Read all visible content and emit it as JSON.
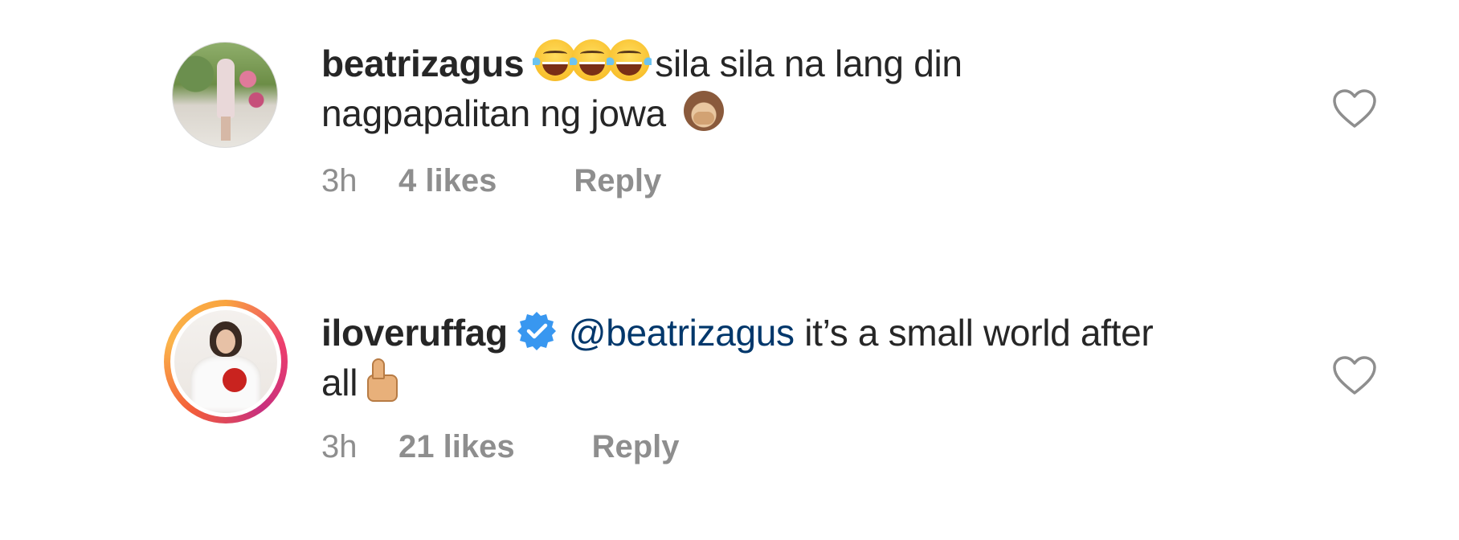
{
  "comments": [
    {
      "username": "beatrizagus",
      "emojis_before": [
        "face-with-tears-of-joy",
        "face-with-tears-of-joy",
        "face-with-tears-of-joy"
      ],
      "text_line1": " sila sila na lang din",
      "text_line2": "nagpapalitan ng jowa",
      "emoji_after": "speak-no-evil-monkey",
      "time": "3h",
      "likes": "4 likes",
      "reply_label": "Reply",
      "like_icon": "heart-outline-icon",
      "avatar": "user-avatar"
    },
    {
      "username": "iloveruffag",
      "verified_icon": "verified-badge-icon",
      "mention": "@beatrizagus",
      "text": " it’s a small world after",
      "text_line2": "all",
      "emoji_after": "thumbs-up",
      "time": "3h",
      "likes": "21 likes",
      "reply_label": "Reply",
      "like_icon": "heart-outline-icon",
      "avatar": "user-avatar-story-ring"
    }
  ],
  "colors": {
    "text": "#262626",
    "secondary": "#8e8e8e",
    "mention": "#00376b",
    "verified": "#3897f0",
    "story_ring": [
      "#f9a43f",
      "#ed3e6d",
      "#c8307e"
    ]
  }
}
